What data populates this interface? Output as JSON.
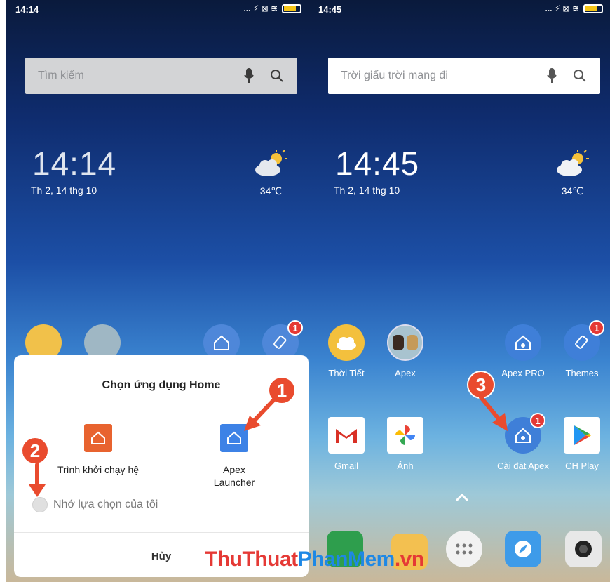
{
  "left": {
    "status": {
      "time": "14:14",
      "icons": "... ⚡ ⊠ ≋"
    },
    "search": {
      "placeholder": "Tìm kiếm"
    },
    "clock": {
      "time": "14:14",
      "date": "Th 2, 14 thg 10",
      "temp": "34℃"
    },
    "dialog": {
      "title": "Chọn ứng dụng Home",
      "choices": [
        {
          "label": "Trình khởi chạy hệ",
          "icon": "home-icon",
          "color": "#e8632f"
        },
        {
          "label": "Apex Launcher",
          "icon": "home-icon",
          "color": "#3d82e6"
        }
      ],
      "remember": "Nhớ lựa chọn của tôi",
      "cancel": "Hủy"
    },
    "badges": {
      "themes": "1"
    }
  },
  "right": {
    "status": {
      "time": "14:45",
      "icons": "... ⚡ ⊠ ≋"
    },
    "search": {
      "placeholder": "Trời giấu trời mang đi"
    },
    "clock": {
      "time": "14:45",
      "date": "Th 2, 14 thg 10",
      "temp": "34℃"
    },
    "apps_row1": [
      {
        "label": "Thời Tiết",
        "icon": "weather-icon"
      },
      {
        "label": "Apex",
        "icon": "folder-icon"
      },
      {
        "label": "Apex PRO",
        "icon": "apex-pro-icon"
      },
      {
        "label": "Themes",
        "icon": "themes-icon",
        "badge": "1"
      }
    ],
    "apps_row2": [
      {
        "label": "Gmail",
        "icon": "gmail-icon"
      },
      {
        "label": "Ảnh",
        "icon": "photos-icon"
      },
      {
        "label": "Cài đặt Apex",
        "icon": "apex-settings-icon",
        "badge": "1"
      },
      {
        "label": "CH Play",
        "icon": "play-store-icon"
      }
    ]
  },
  "callouts": [
    "1",
    "2",
    "3"
  ],
  "watermark": {
    "part1": "ThuThuat",
    "part2": "PhanMem",
    "part3": ".vn"
  },
  "colors": {
    "callout": "#e94b2e",
    "apex_blue": "#3d82e6",
    "orange": "#e8632f"
  }
}
